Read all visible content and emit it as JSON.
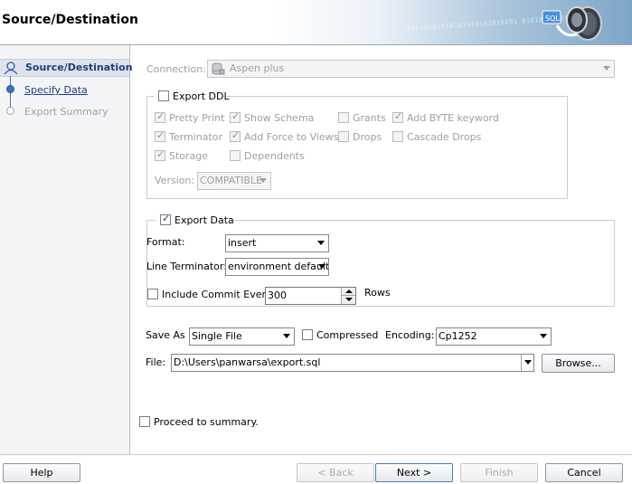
{
  "header": {
    "title": "Source/Destination",
    "binary_text": "01010101010101010101010101 010101010101"
  },
  "nav": {
    "items": [
      {
        "label": "Source/Destination"
      },
      {
        "label": "Specify Data"
      },
      {
        "label": "Export Summary"
      }
    ]
  },
  "connection": {
    "label": "Connection:",
    "value": "Aspen plus"
  },
  "export_ddl": {
    "label": "Export DDL",
    "options": {
      "pretty_print": "Pretty Print",
      "show_schema": "Show Schema",
      "grants": "Grants",
      "add_byte_keyword": "Add BYTE keyword",
      "terminator": "Terminator",
      "add_force_to_views": "Add Force to Views",
      "drops": "Drops",
      "cascade_drops": "Cascade Drops",
      "storage": "Storage",
      "dependents": "Dependents"
    },
    "version_label": "Version:",
    "version_value": "COMPATIBLE"
  },
  "export_data": {
    "label": "Export Data",
    "format_label": "Format:",
    "format_value": "insert",
    "line_terminator_label": "Line Terminator:",
    "line_terminator_value": "environment default",
    "commit_label": "Include Commit Every",
    "commit_value": "300",
    "rows_label": "Rows"
  },
  "save": {
    "save_as_label": "Save As",
    "save_as_value": "Single File",
    "compressed_label": "Compressed",
    "encoding_label": "Encoding:",
    "encoding_value": "Cp1252",
    "file_label": "File:",
    "file_value": "D:\\Users\\panwarsa\\export.sql",
    "browse_label": "Browse..."
  },
  "proceed_label": "Proceed to summary.",
  "footer": {
    "help": "Help",
    "back": "< Back",
    "next": "Next >",
    "finish": "Finish",
    "cancel": "Cancel"
  }
}
